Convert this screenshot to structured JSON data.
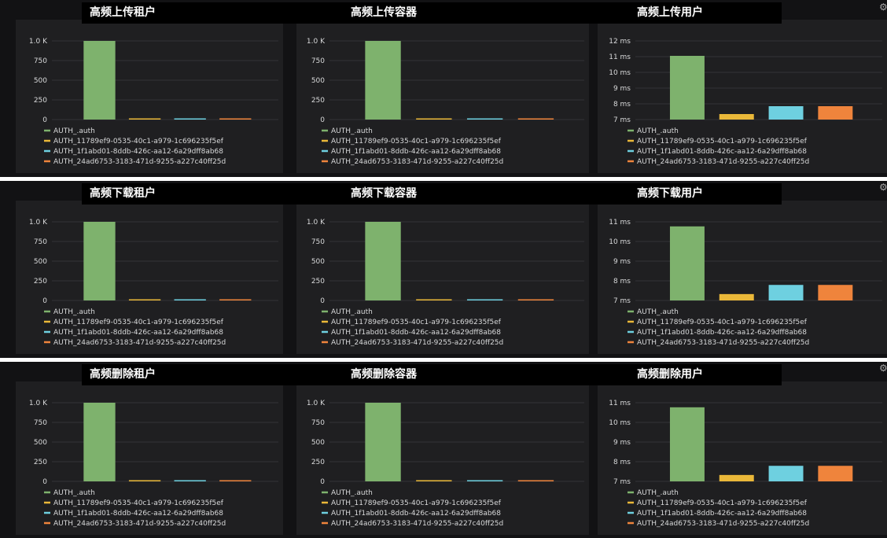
{
  "colors": {
    "background": "#121214",
    "panel": "#1f1f21",
    "grid": "#333336",
    "axis_text": "#d8d9da",
    "green": "#7eb26d",
    "yellow": "#eab839",
    "cyan": "#6ed0e0",
    "orange": "#ef843c"
  },
  "legend": [
    "AUTH_.auth",
    "AUTH_11789ef9-0535-40c1-a979-1c696235f5ef",
    "AUTH_1f1abd01-8ddb-426c-aa12-6a29dff8ab68",
    "AUTH_24ad6753-3183-471d-9255-a227c40ff25d"
  ],
  "rows": [
    {
      "titles": [
        "高频上传租户",
        "高频上传容器",
        "高频上传用户"
      ]
    },
    {
      "titles": [
        "高频下载租户",
        "高频下载容器",
        "高频下载用户"
      ]
    },
    {
      "titles": [
        "高频删除租户",
        "高频删除容器",
        "高频删除用户"
      ]
    }
  ],
  "chart_data": [
    {
      "type": "bar",
      "group": "upload-tenant",
      "categories": [
        "AUTH_.auth",
        "AUTH_11789ef9-0535-40c1-a979-1c696235f5ef",
        "AUTH_1f1abd01-8ddb-426c-aa12-6a29dff8ab68",
        "AUTH_24ad6753-3183-471d-9255-a227c40ff25d"
      ],
      "values": [
        1000,
        8,
        8,
        8
      ],
      "yticks": [
        "0",
        "250",
        "500",
        "750",
        "1.0 K"
      ],
      "ylim": [
        0,
        1000
      ]
    },
    {
      "type": "bar",
      "group": "upload-container",
      "categories": [
        "AUTH_.auth",
        "AUTH_11789ef9-0535-40c1-a979-1c696235f5ef",
        "AUTH_1f1abd01-8ddb-426c-aa12-6a29dff8ab68",
        "AUTH_24ad6753-3183-471d-9255-a227c40ff25d"
      ],
      "values": [
        1000,
        8,
        8,
        8
      ],
      "yticks": [
        "0",
        "250",
        "500",
        "750",
        "1.0 K"
      ],
      "ylim": [
        0,
        1000
      ]
    },
    {
      "type": "bar",
      "group": "upload-user",
      "categories": [
        "AUTH_.auth",
        "AUTH_11789ef9-0535-40c1-a979-1c696235f5ef",
        "AUTH_1f1abd01-8ddb-426c-aa12-6a29dff8ab68",
        "AUTH_24ad6753-3183-471d-9255-a227c40ff25d"
      ],
      "values": [
        11.05,
        7.35,
        7.85,
        7.85
      ],
      "yticks": [
        "7 ms",
        "8 ms",
        "9 ms",
        "10 ms",
        "11 ms",
        "12 ms"
      ],
      "ylim": [
        7,
        12
      ]
    },
    {
      "type": "bar",
      "group": "download-tenant",
      "categories": [
        "AUTH_.auth",
        "AUTH_11789ef9-0535-40c1-a979-1c696235f5ef",
        "AUTH_1f1abd01-8ddb-426c-aa12-6a29dff8ab68",
        "AUTH_24ad6753-3183-471d-9255-a227c40ff25d"
      ],
      "values": [
        1000,
        8,
        8,
        8
      ],
      "yticks": [
        "0",
        "250",
        "500",
        "750",
        "1.0 K"
      ],
      "ylim": [
        0,
        1000
      ]
    },
    {
      "type": "bar",
      "group": "download-container",
      "categories": [
        "AUTH_.auth",
        "AUTH_11789ef9-0535-40c1-a979-1c696235f5ef",
        "AUTH_1f1abd01-8ddb-426c-aa12-6a29dff8ab68",
        "AUTH_24ad6753-3183-471d-9255-a227c40ff25d"
      ],
      "values": [
        1000,
        8,
        8,
        8
      ],
      "yticks": [
        "0",
        "250",
        "500",
        "750",
        "1.0 K"
      ],
      "ylim": [
        0,
        1000
      ]
    },
    {
      "type": "bar",
      "group": "download-user",
      "categories": [
        "AUTH_.auth",
        "AUTH_11789ef9-0535-40c1-a979-1c696235f5ef",
        "AUTH_1f1abd01-8ddb-426c-aa12-6a29dff8ab68",
        "AUTH_24ad6753-3183-471d-9255-a227c40ff25d"
      ],
      "values": [
        11.05,
        7.35,
        7.85,
        7.85
      ],
      "yticks": [
        "7 ms",
        "8 ms",
        "9 ms",
        "10 ms",
        "11 ms"
      ],
      "ylim": [
        7,
        11.3
      ]
    },
    {
      "type": "bar",
      "group": "delete-tenant",
      "categories": [
        "AUTH_.auth",
        "AUTH_11789ef9-0535-40c1-a979-1c696235f5ef",
        "AUTH_1f1abd01-8ddb-426c-aa12-6a29dff8ab68",
        "AUTH_24ad6753-3183-471d-9255-a227c40ff25d"
      ],
      "values": [
        1000,
        8,
        8,
        8
      ],
      "yticks": [
        "0",
        "250",
        "500",
        "750",
        "1.0 K"
      ],
      "ylim": [
        0,
        1000
      ]
    },
    {
      "type": "bar",
      "group": "delete-container",
      "categories": [
        "AUTH_.auth",
        "AUTH_11789ef9-0535-40c1-a979-1c696235f5ef",
        "AUTH_1f1abd01-8ddb-426c-aa12-6a29dff8ab68",
        "AUTH_24ad6753-3183-471d-9255-a227c40ff25d"
      ],
      "values": [
        1000,
        8,
        8,
        8
      ],
      "yticks": [
        "0",
        "250",
        "500",
        "750",
        "1.0 K"
      ],
      "ylim": [
        0,
        1000
      ]
    },
    {
      "type": "bar",
      "group": "delete-user",
      "categories": [
        "AUTH_.auth",
        "AUTH_11789ef9-0535-40c1-a979-1c696235f5ef",
        "AUTH_1f1abd01-8ddb-426c-aa12-6a29dff8ab68",
        "AUTH_24ad6753-3183-471d-9255-a227c40ff25d"
      ],
      "values": [
        11.05,
        7.35,
        7.85,
        7.85
      ],
      "yticks": [
        "7 ms",
        "8 ms",
        "9 ms",
        "10 ms",
        "11 ms"
      ],
      "ylim": [
        7,
        11.3
      ]
    }
  ]
}
